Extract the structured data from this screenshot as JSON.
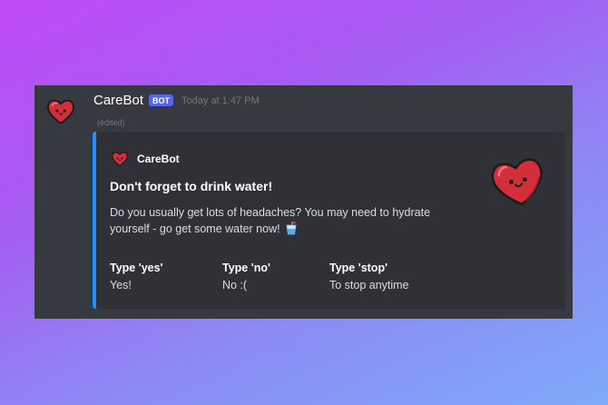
{
  "message": {
    "username": "CareBot",
    "badge": "BOT",
    "timestamp": "Today at 1:47 PM",
    "edited": "(edited)",
    "avatar_icon": "heart-face-icon"
  },
  "embed": {
    "accent_color": "#1e90ff",
    "author_name": "CareBot",
    "author_icon": "heart-face-icon",
    "title": "Don't forget to drink water!",
    "description": "Do you usually get lots of headaches? You may need to hydrate yourself - go get some water now!",
    "description_emoji": "cup-with-straw-icon",
    "thumbnail_icon": "heart-face-icon",
    "fields": [
      {
        "name": "Type 'yes'",
        "value": "Yes!"
      },
      {
        "name": "Type 'no'",
        "value": "No :("
      },
      {
        "name": "Type 'stop'",
        "value": "To stop anytime"
      }
    ]
  },
  "colors": {
    "background_start": "#c04cf6",
    "background_end": "#7eaaf8",
    "message_bg": "#36393f",
    "embed_bg": "#2f3136",
    "badge_bg": "#5865f2",
    "heart_red": "#d32f3a"
  }
}
